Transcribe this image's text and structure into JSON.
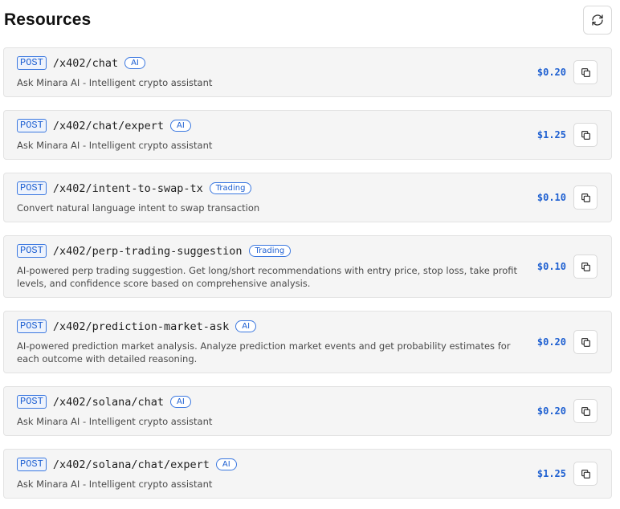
{
  "header": {
    "title": "Resources",
    "refresh_icon": "refresh-icon"
  },
  "resources": [
    {
      "method": "POST",
      "path": "/x402/chat",
      "tag": "AI",
      "description": "Ask Minara AI - Intelligent crypto assistant",
      "price": "$0.20",
      "copy_icon": "copy-icon"
    },
    {
      "method": "POST",
      "path": "/x402/chat/expert",
      "tag": "AI",
      "description": "Ask Minara AI - Intelligent crypto assistant",
      "price": "$1.25",
      "copy_icon": "copy-icon"
    },
    {
      "method": "POST",
      "path": "/x402/intent-to-swap-tx",
      "tag": "Trading",
      "description": "Convert natural language intent to swap transaction",
      "price": "$0.10",
      "copy_icon": "copy-icon"
    },
    {
      "method": "POST",
      "path": "/x402/perp-trading-suggestion",
      "tag": "Trading",
      "description": "AI-powered perp trading suggestion. Get long/short recommendations with entry price, stop loss, take profit levels, and confidence score based on comprehensive analysis.",
      "price": "$0.10",
      "copy_icon": "copy-icon"
    },
    {
      "method": "POST",
      "path": "/x402/prediction-market-ask",
      "tag": "AI",
      "description": "AI-powered prediction market analysis. Analyze prediction market events and get probability estimates for each outcome with detailed reasoning.",
      "price": "$0.20",
      "copy_icon": "copy-icon"
    },
    {
      "method": "POST",
      "path": "/x402/solana/chat",
      "tag": "AI",
      "description": "Ask Minara AI - Intelligent crypto assistant",
      "price": "$0.20",
      "copy_icon": "copy-icon"
    },
    {
      "method": "POST",
      "path": "/x402/solana/chat/expert",
      "tag": "AI",
      "description": "Ask Minara AI - Intelligent crypto assistant",
      "price": "$1.25",
      "copy_icon": "copy-icon"
    }
  ],
  "colors": {
    "accent": "#1d5fd1",
    "card_bg": "#f5f5f5",
    "card_border": "#e3e3e3"
  }
}
